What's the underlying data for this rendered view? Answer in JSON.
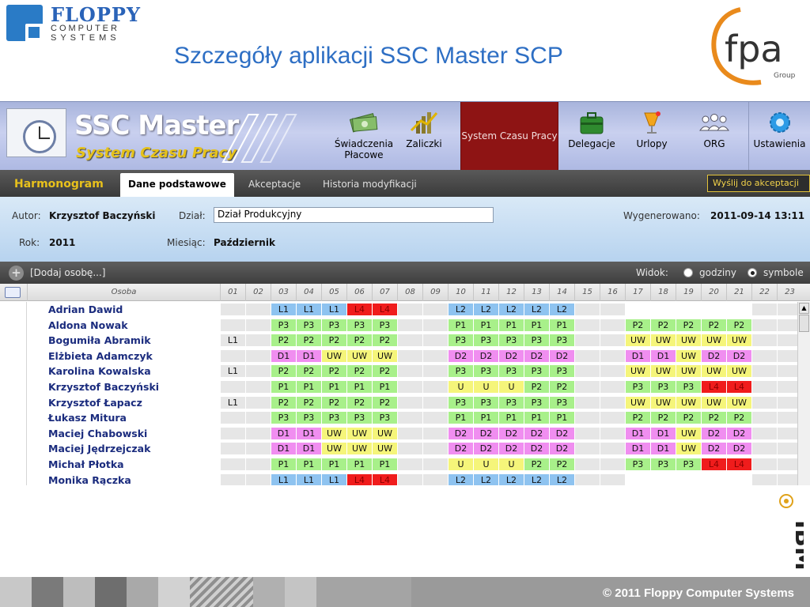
{
  "slide": {
    "title": "Szczegóły aplikacji SSC Master SCP",
    "floppy_logo": {
      "word": "FLOPPY",
      "line1": "COMPUTER",
      "line2": "SYSTEMS",
      "color": "#2a63b8"
    },
    "fpa_logo": {
      "text": "fpa",
      "sub": "Group"
    },
    "ibm_logo": {
      "text": "IBM"
    },
    "footer": "© 2011 Floppy Computer Systems"
  },
  "app": {
    "brand": {
      "title": "SSC Master",
      "subtitle": "System Czasu Pracy"
    },
    "modules": [
      {
        "label": "Świadczenia Płacowe",
        "icon": "money-icon"
      },
      {
        "label": "Zaliczki",
        "icon": "chart-coins-icon"
      },
      {
        "label": "System Czasu Pracy",
        "icon": "",
        "active": true
      },
      {
        "label": "Delegacje",
        "icon": "briefcase-icon"
      },
      {
        "label": "Urlopy",
        "icon": "drink-icon"
      },
      {
        "label": "ORG",
        "icon": "people-icon"
      },
      {
        "label": "Ustawienia",
        "icon": "gear-icon"
      }
    ],
    "tabs": {
      "main": "Harmonogram",
      "items": [
        "Dane podstawowe",
        "Akceptacje",
        "Historia modyfikacji"
      ],
      "active": "Dane podstawowe",
      "send_button": "Wyślij do akceptacji ▸"
    },
    "info": {
      "autor_label": "Autor:",
      "autor_value": "Krzysztof Baczyński",
      "dzial_label": "Dział:",
      "dzial_value": "Dział Produkcyjny",
      "wygenerowano_label": "Wygenerowano:",
      "wygenerowano_value": "2011-09-14 13:11",
      "rok_label": "Rok:",
      "rok_value": "2011",
      "miesiac_label": "Miesiąc:",
      "miesiac_value": "Październik"
    },
    "toolbar": {
      "add_label": "[Dodaj osobę...]",
      "widok_label": "Widok:",
      "opt_hours": "godziny",
      "opt_symbols": "symbole",
      "selected": "symbole"
    },
    "grid": {
      "person_header": "Osoba",
      "days": [
        "01",
        "02",
        "03",
        "04",
        "05",
        "06",
        "07",
        "08",
        "09",
        "10",
        "11",
        "12",
        "13",
        "14",
        "15",
        "16",
        "17",
        "18",
        "19",
        "20",
        "21",
        "22",
        "23"
      ],
      "colors": {
        "L": "#8ec3f0",
        "L4": "#f01c1c",
        "P": "#a8f08a",
        "D": "#f08ef0",
        "UW": "#f5f57a",
        "U": "#f5f57a",
        "weekend": "#e6e6e6",
        "empty": "#ffffff"
      },
      "rows": [
        {
          "name": "Adrian Dawid",
          "cells": [
            "",
            "",
            "L1",
            "L1",
            "L1",
            "L4",
            "L4",
            "",
            "",
            "L2",
            "L2",
            "L2",
            "L2",
            "L2",
            "",
            "",
            "",
            "",
            "",
            "",
            "",
            "",
            ""
          ]
        },
        {
          "name": "Aldona Nowak",
          "cells": [
            "",
            "",
            "P3",
            "P3",
            "P3",
            "P3",
            "P3",
            "",
            "",
            "P1",
            "P1",
            "P1",
            "P1",
            "P1",
            "",
            "",
            "P2",
            "P2",
            "P2",
            "P2",
            "P2",
            "",
            ""
          ]
        },
        {
          "name": "Bogumiła Abramik",
          "cells": [
            "L1",
            "",
            "P2",
            "P2",
            "P2",
            "P2",
            "P2",
            "",
            "",
            "P3",
            "P3",
            "P3",
            "P3",
            "P3",
            "",
            "",
            "UW",
            "UW",
            "UW",
            "UW",
            "UW",
            "",
            ""
          ]
        },
        {
          "name": "Elżbieta Adamczyk",
          "cells": [
            "",
            "",
            "D1",
            "D1",
            "UW",
            "UW",
            "UW",
            "",
            "",
            "D2",
            "D2",
            "D2",
            "D2",
            "D2",
            "",
            "",
            "D1",
            "D1",
            "UW",
            "D2",
            "D2",
            "",
            ""
          ]
        },
        {
          "name": "Karolina Kowalska",
          "cells": [
            "L1",
            "",
            "P2",
            "P2",
            "P2",
            "P2",
            "P2",
            "",
            "",
            "P3",
            "P3",
            "P3",
            "P3",
            "P3",
            "",
            "",
            "UW",
            "UW",
            "UW",
            "UW",
            "UW",
            "",
            ""
          ]
        },
        {
          "name": "Krzysztof Baczyński",
          "cells": [
            "",
            "",
            "P1",
            "P1",
            "P1",
            "P1",
            "P1",
            "",
            "",
            "U",
            "U",
            "U",
            "P2",
            "P2",
            "",
            "",
            "P3",
            "P3",
            "P3",
            "L4",
            "L4",
            "",
            ""
          ]
        },
        {
          "name": "Krzysztof Łapacz",
          "cells": [
            "L1",
            "",
            "P2",
            "P2",
            "P2",
            "P2",
            "P2",
            "",
            "",
            "P3",
            "P3",
            "P3",
            "P3",
            "P3",
            "",
            "",
            "UW",
            "UW",
            "UW",
            "UW",
            "UW",
            "",
            ""
          ]
        },
        {
          "name": "Łukasz Mitura",
          "cells": [
            "",
            "",
            "P3",
            "P3",
            "P3",
            "P3",
            "P3",
            "",
            "",
            "P1",
            "P1",
            "P1",
            "P1",
            "P1",
            "",
            "",
            "P2",
            "P2",
            "P2",
            "P2",
            "P2",
            "",
            ""
          ]
        },
        {
          "name": "Maciej Chabowski",
          "cells": [
            "",
            "",
            "D1",
            "D1",
            "UW",
            "UW",
            "UW",
            "",
            "",
            "D2",
            "D2",
            "D2",
            "D2",
            "D2",
            "",
            "",
            "D1",
            "D1",
            "UW",
            "D2",
            "D2",
            "",
            ""
          ]
        },
        {
          "name": "Maciej Jędrzejczak",
          "cells": [
            "",
            "",
            "D1",
            "D1",
            "UW",
            "UW",
            "UW",
            "",
            "",
            "D2",
            "D2",
            "D2",
            "D2",
            "D2",
            "",
            "",
            "D1",
            "D1",
            "UW",
            "D2",
            "D2",
            "",
            ""
          ]
        },
        {
          "name": "Michał Płotka",
          "cells": [
            "",
            "",
            "P1",
            "P1",
            "P1",
            "P1",
            "P1",
            "",
            "",
            "U",
            "U",
            "U",
            "P2",
            "P2",
            "",
            "",
            "P3",
            "P3",
            "P3",
            "L4",
            "L4",
            "",
            ""
          ]
        },
        {
          "name": "Monika Rączka",
          "cells": [
            "",
            "",
            "L1",
            "L1",
            "L1",
            "L4",
            "L4",
            "",
            "",
            "L2",
            "L2",
            "L2",
            "L2",
            "L2",
            "",
            "",
            "",
            "",
            "",
            "",
            "",
            "",
            ""
          ]
        }
      ]
    }
  }
}
